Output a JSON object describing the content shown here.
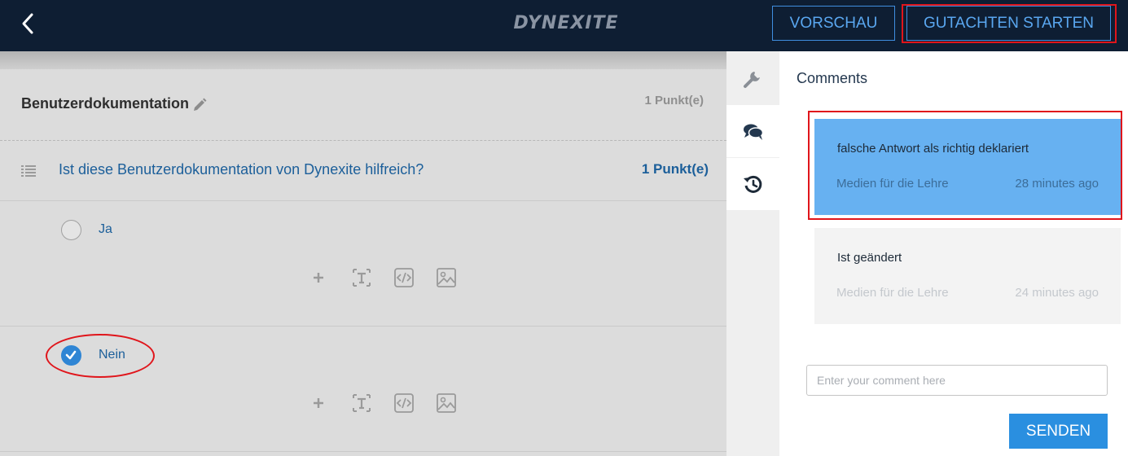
{
  "header": {
    "logo_text": "DYNEXITE",
    "preview_label": "VORSCHAU",
    "start_label": "GUTACHTEN STARTEN",
    "back_icon": "chevron-left-icon"
  },
  "task": {
    "title": "Benutzerdokumentation",
    "points": "1 Punkt(e)",
    "edit_icon": "pencil-icon"
  },
  "question": {
    "text": "Ist diese Benutzerdokumentation von Dynexite hilfreich?",
    "points": "1 Punkt(e)",
    "icon": "list-icon"
  },
  "answers": [
    {
      "label": "Ja",
      "checked": false
    },
    {
      "label": "Nein",
      "checked": true
    }
  ],
  "answer_tools": [
    "plus-icon",
    "text-icon",
    "code-icon",
    "image-icon"
  ],
  "side_tabs": [
    {
      "name": "settings",
      "icon": "wrench-icon",
      "active": false
    },
    {
      "name": "comments",
      "icon": "comments-icon",
      "active": true
    },
    {
      "name": "history",
      "icon": "history-icon",
      "active": false
    }
  ],
  "comments_panel": {
    "title": "Comments",
    "comments": [
      {
        "text": "falsche Antwort als richtig deklariert",
        "author": "Medien für die Lehre",
        "time": "28 minutes ago",
        "selected": true
      },
      {
        "text": "Ist geändert",
        "author": "Medien für die Lehre",
        "time": "24 minutes ago",
        "selected": false
      }
    ],
    "input_placeholder": "Enter your comment here",
    "send_label": "SENDEN"
  },
  "colors": {
    "header_bg": "#0e1e33",
    "accent": "#2a8fe0",
    "selected_comment": "#67b1f1",
    "annotation_red": "#e0151b",
    "question_text": "#1c5f9a"
  }
}
